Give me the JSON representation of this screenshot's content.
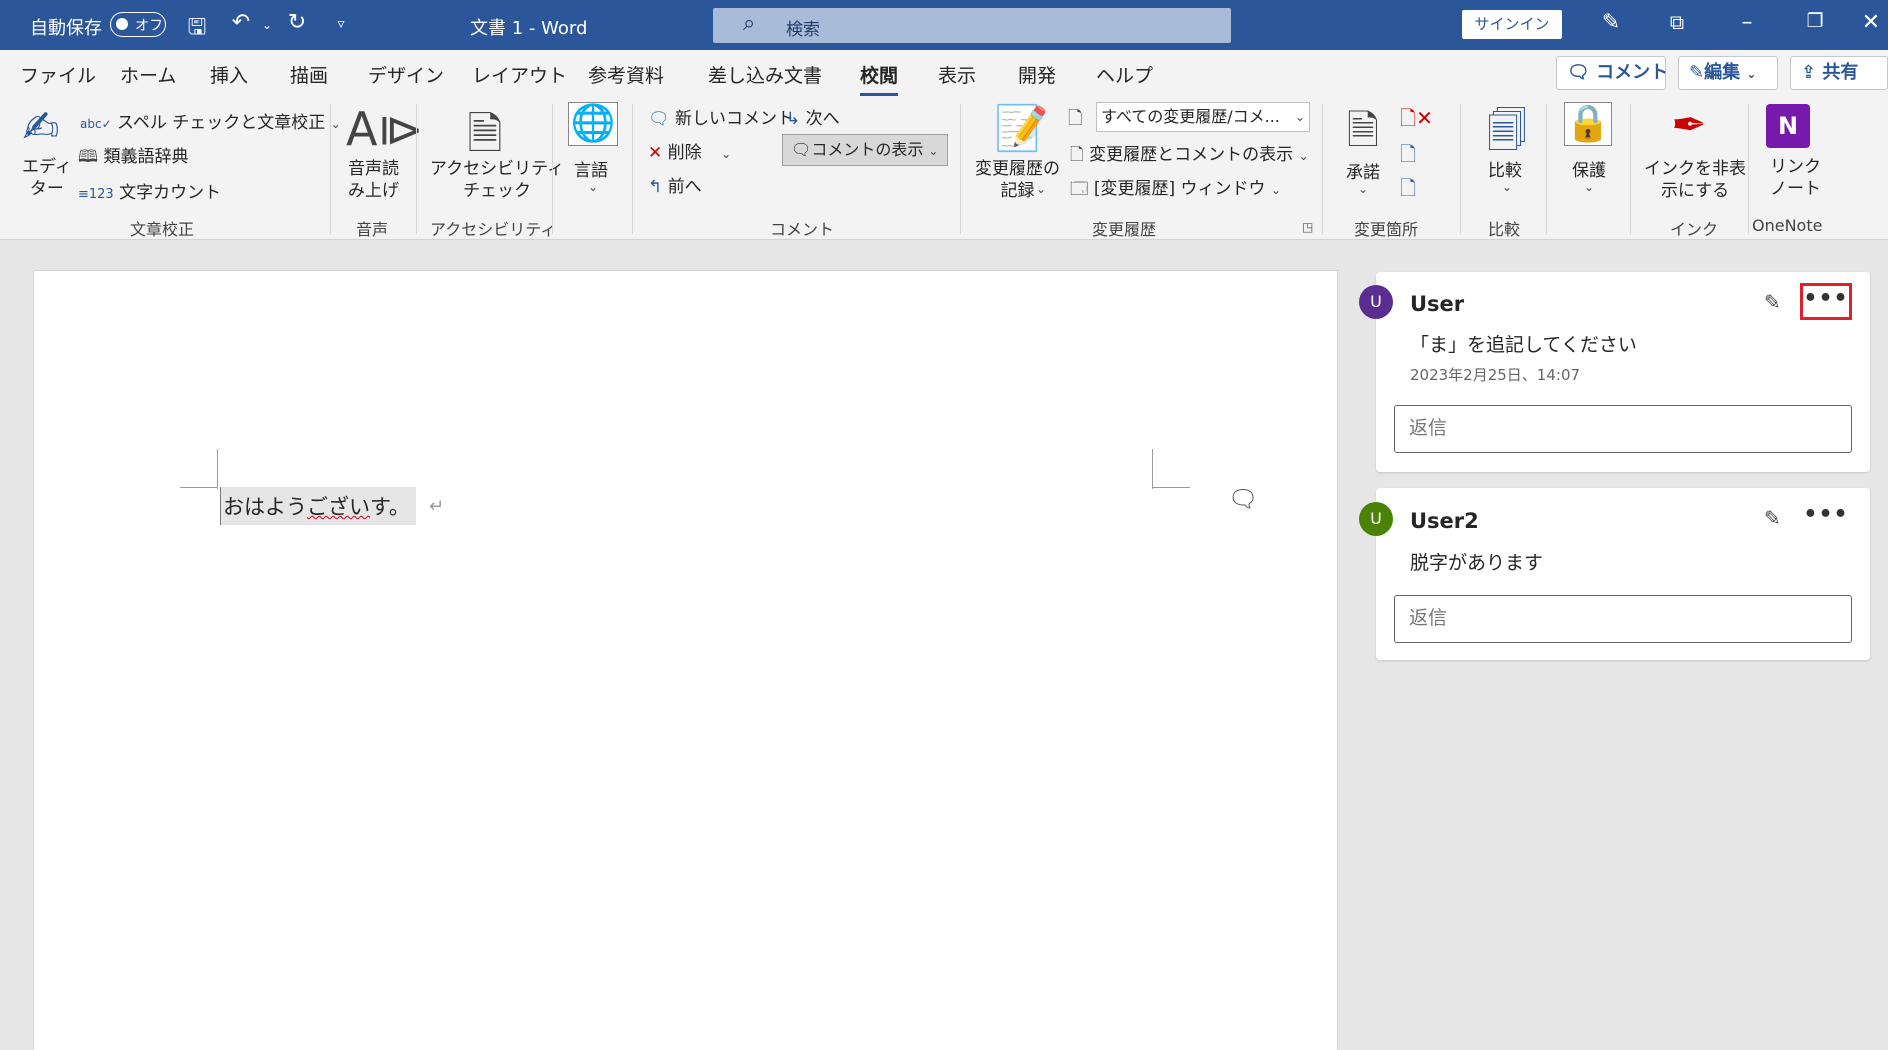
{
  "titlebar": {
    "autosave_label": "自動保存",
    "autosave_state": "オフ",
    "doc_title": "文書 1  -  Word",
    "search_placeholder": "検索",
    "signin": "サインイン",
    "accent": "#2b579a"
  },
  "tabs": [
    "ファイル",
    "ホーム",
    "挿入",
    "描画",
    "デザイン",
    "レイアウト",
    "参考資料",
    "差し込み文書",
    "校閲",
    "表示",
    "開発",
    "ヘルプ"
  ],
  "active_tab": "校閲",
  "tab_buttons": {
    "comment": "コメント",
    "edit": "編集",
    "share": "共有"
  },
  "ribbon": {
    "editor": "エディ\nター",
    "spell": "スペル チェックと文章校正",
    "thesaurus": "類義語辞典",
    "wordcount": "文字カウント",
    "group_proofing": "文章校正",
    "read_aloud": "音声読\nみ上げ",
    "group_speech": "音声",
    "accessibility": "アクセシビリティ\nチェック",
    "group_accessibility": "アクセシビリティ",
    "language": "言語",
    "new_comment": "新しいコメント",
    "delete": "削除",
    "prev": "前へ",
    "next": "次へ",
    "show_comments": "コメントの表示",
    "group_comments": "コメント",
    "track_changes": "変更履歴の\n記録",
    "markup_select": "すべての変更履歴/コメ...",
    "show_markup": "変更履歴とコメントの表示",
    "reviewing_pane": "[変更履歴] ウィンドウ",
    "group_tracking": "変更履歴",
    "accept": "承諾",
    "group_changes": "変更箇所",
    "compare": "比較",
    "group_compare": "比較",
    "protect": "保護",
    "hide_ink": "インクを非表\n示にする",
    "group_ink": "インク",
    "linked_notes": "リンク\nノート",
    "group_onenote": "OneNote"
  },
  "document": {
    "text_plain_1": "おはよう",
    "text_squiggle": "ござい",
    "text_plain_2": "す。"
  },
  "comments": [
    {
      "author": "User",
      "text": "「ま」を追記してください",
      "date": "2023年2月25日、14:07",
      "reply_placeholder": "返信",
      "avatar_letter": "U",
      "avatar_color": "#5c2d91"
    },
    {
      "author": "User2",
      "text": "脱字があります",
      "reply_placeholder": "返信",
      "avatar_letter": "U",
      "avatar_color": "#498205"
    }
  ]
}
